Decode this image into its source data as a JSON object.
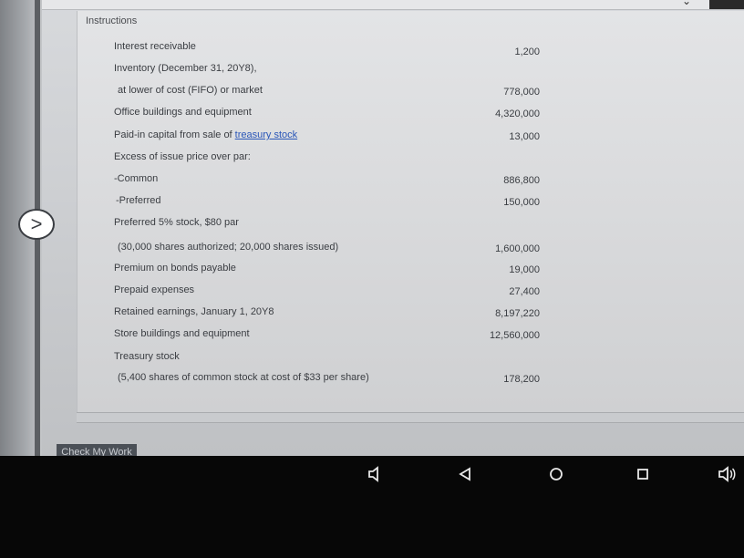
{
  "panel": {
    "title": "Instructions",
    "rows": [
      {
        "label": "Interest receivable",
        "amount": "1,200"
      },
      {
        "label": "Inventory (December 31, 20Y8),",
        "amount": ""
      },
      {
        "label": "at lower of cost (FIFO) or market",
        "amount": "778,000"
      },
      {
        "label": "Office buildings and equipment",
        "amount": "4,320,000"
      },
      {
        "label": "Paid-in capital from sale of ",
        "link": "treasury stock",
        "amount": "13,000"
      },
      {
        "label": "Excess of issue price over par:",
        "amount": ""
      },
      {
        "label": "-Common",
        "amount": "886,800"
      },
      {
        "label": "-Preferred",
        "amount": "150,000"
      },
      {
        "label": "Preferred 5% stock, $80 par",
        "amount": ""
      },
      {
        "label": "(30,000 shares authorized; 20,000 shares issued)",
        "amount": "1,600,000"
      },
      {
        "label": "Premium on bonds payable",
        "amount": "19,000"
      },
      {
        "label": "Prepaid expenses",
        "amount": "27,400"
      },
      {
        "label": "Retained earnings, January 1, 20Y8",
        "amount": "8,197,220"
      },
      {
        "label": "Store buildings and equipment",
        "amount": "12,560,000"
      },
      {
        "label": "Treasury stock",
        "amount": ""
      },
      {
        "label": "(5,400 shares of common stock at cost of $33 per share)",
        "amount": "178,200"
      }
    ]
  },
  "footer": {
    "check_button": "Check My Work"
  },
  "nav": {
    "next_glyph": ">"
  },
  "android": {
    "icons": [
      "volume-down-icon",
      "back-icon",
      "home-icon",
      "recents-icon",
      "volume-up-icon"
    ]
  }
}
